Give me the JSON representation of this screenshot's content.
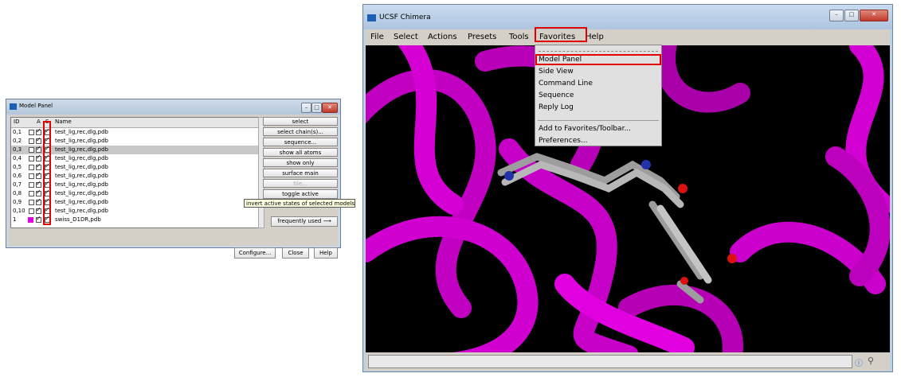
{
  "model_panel": {
    "title": "Model Panel",
    "header": {
      "id": "ID",
      "a": "A",
      "s": "S",
      "name": "Name"
    },
    "rows": [
      {
        "id": "0,1",
        "name": "test_lig,rec,dlg,pdb"
      },
      {
        "id": "0,2",
        "name": "test_lig,rec,dlg,pdb"
      },
      {
        "id": "0,3",
        "name": "test_lig,rec,dlg,pdb"
      },
      {
        "id": "0,4",
        "name": "test_lig,rec,dlg,pdb"
      },
      {
        "id": "0,5",
        "name": "test_lig,rec,dlg,pdb"
      },
      {
        "id": "0,6",
        "name": "test_lig,rec,dlg,pdb"
      },
      {
        "id": "0,7",
        "name": "test_lig,rec,dlg,pdb"
      },
      {
        "id": "0,8",
        "name": "test_lig,rec,dlg,pdb"
      },
      {
        "id": "0,9",
        "name": "test_lig,rec,dlg,pdb"
      },
      {
        "id": "0,10",
        "name": "test_lig,rec,dlg,pdb"
      },
      {
        "id": "1",
        "name": "swiss_D1DR,pdb"
      }
    ],
    "buttons": [
      "select",
      "select chain(s)...",
      "sequence...",
      "show all atoms",
      "show only",
      "surface main",
      "tile...",
      "toggle active"
    ],
    "tooltip": "invert active states of selected models",
    "frequently_used": "frequently used",
    "configure": "Configure...",
    "close": "Close",
    "help": "Help"
  },
  "chimera": {
    "title": "UCSF Chimera",
    "menus": [
      "File",
      "Select",
      "Actions",
      "Presets",
      "Tools",
      "Favorites",
      "Help"
    ],
    "favorites_menu": {
      "items_top": [
        "Model Panel",
        "Side View",
        "Command Line",
        "Sequence",
        "Reply Log"
      ],
      "items_bottom": [
        "Add to Favorites/Toolbar...",
        "Preferences..."
      ]
    }
  },
  "colors": {
    "ribbon": "#d100d1",
    "highlight": "#e30000",
    "ligand": "#9a9a9a"
  }
}
